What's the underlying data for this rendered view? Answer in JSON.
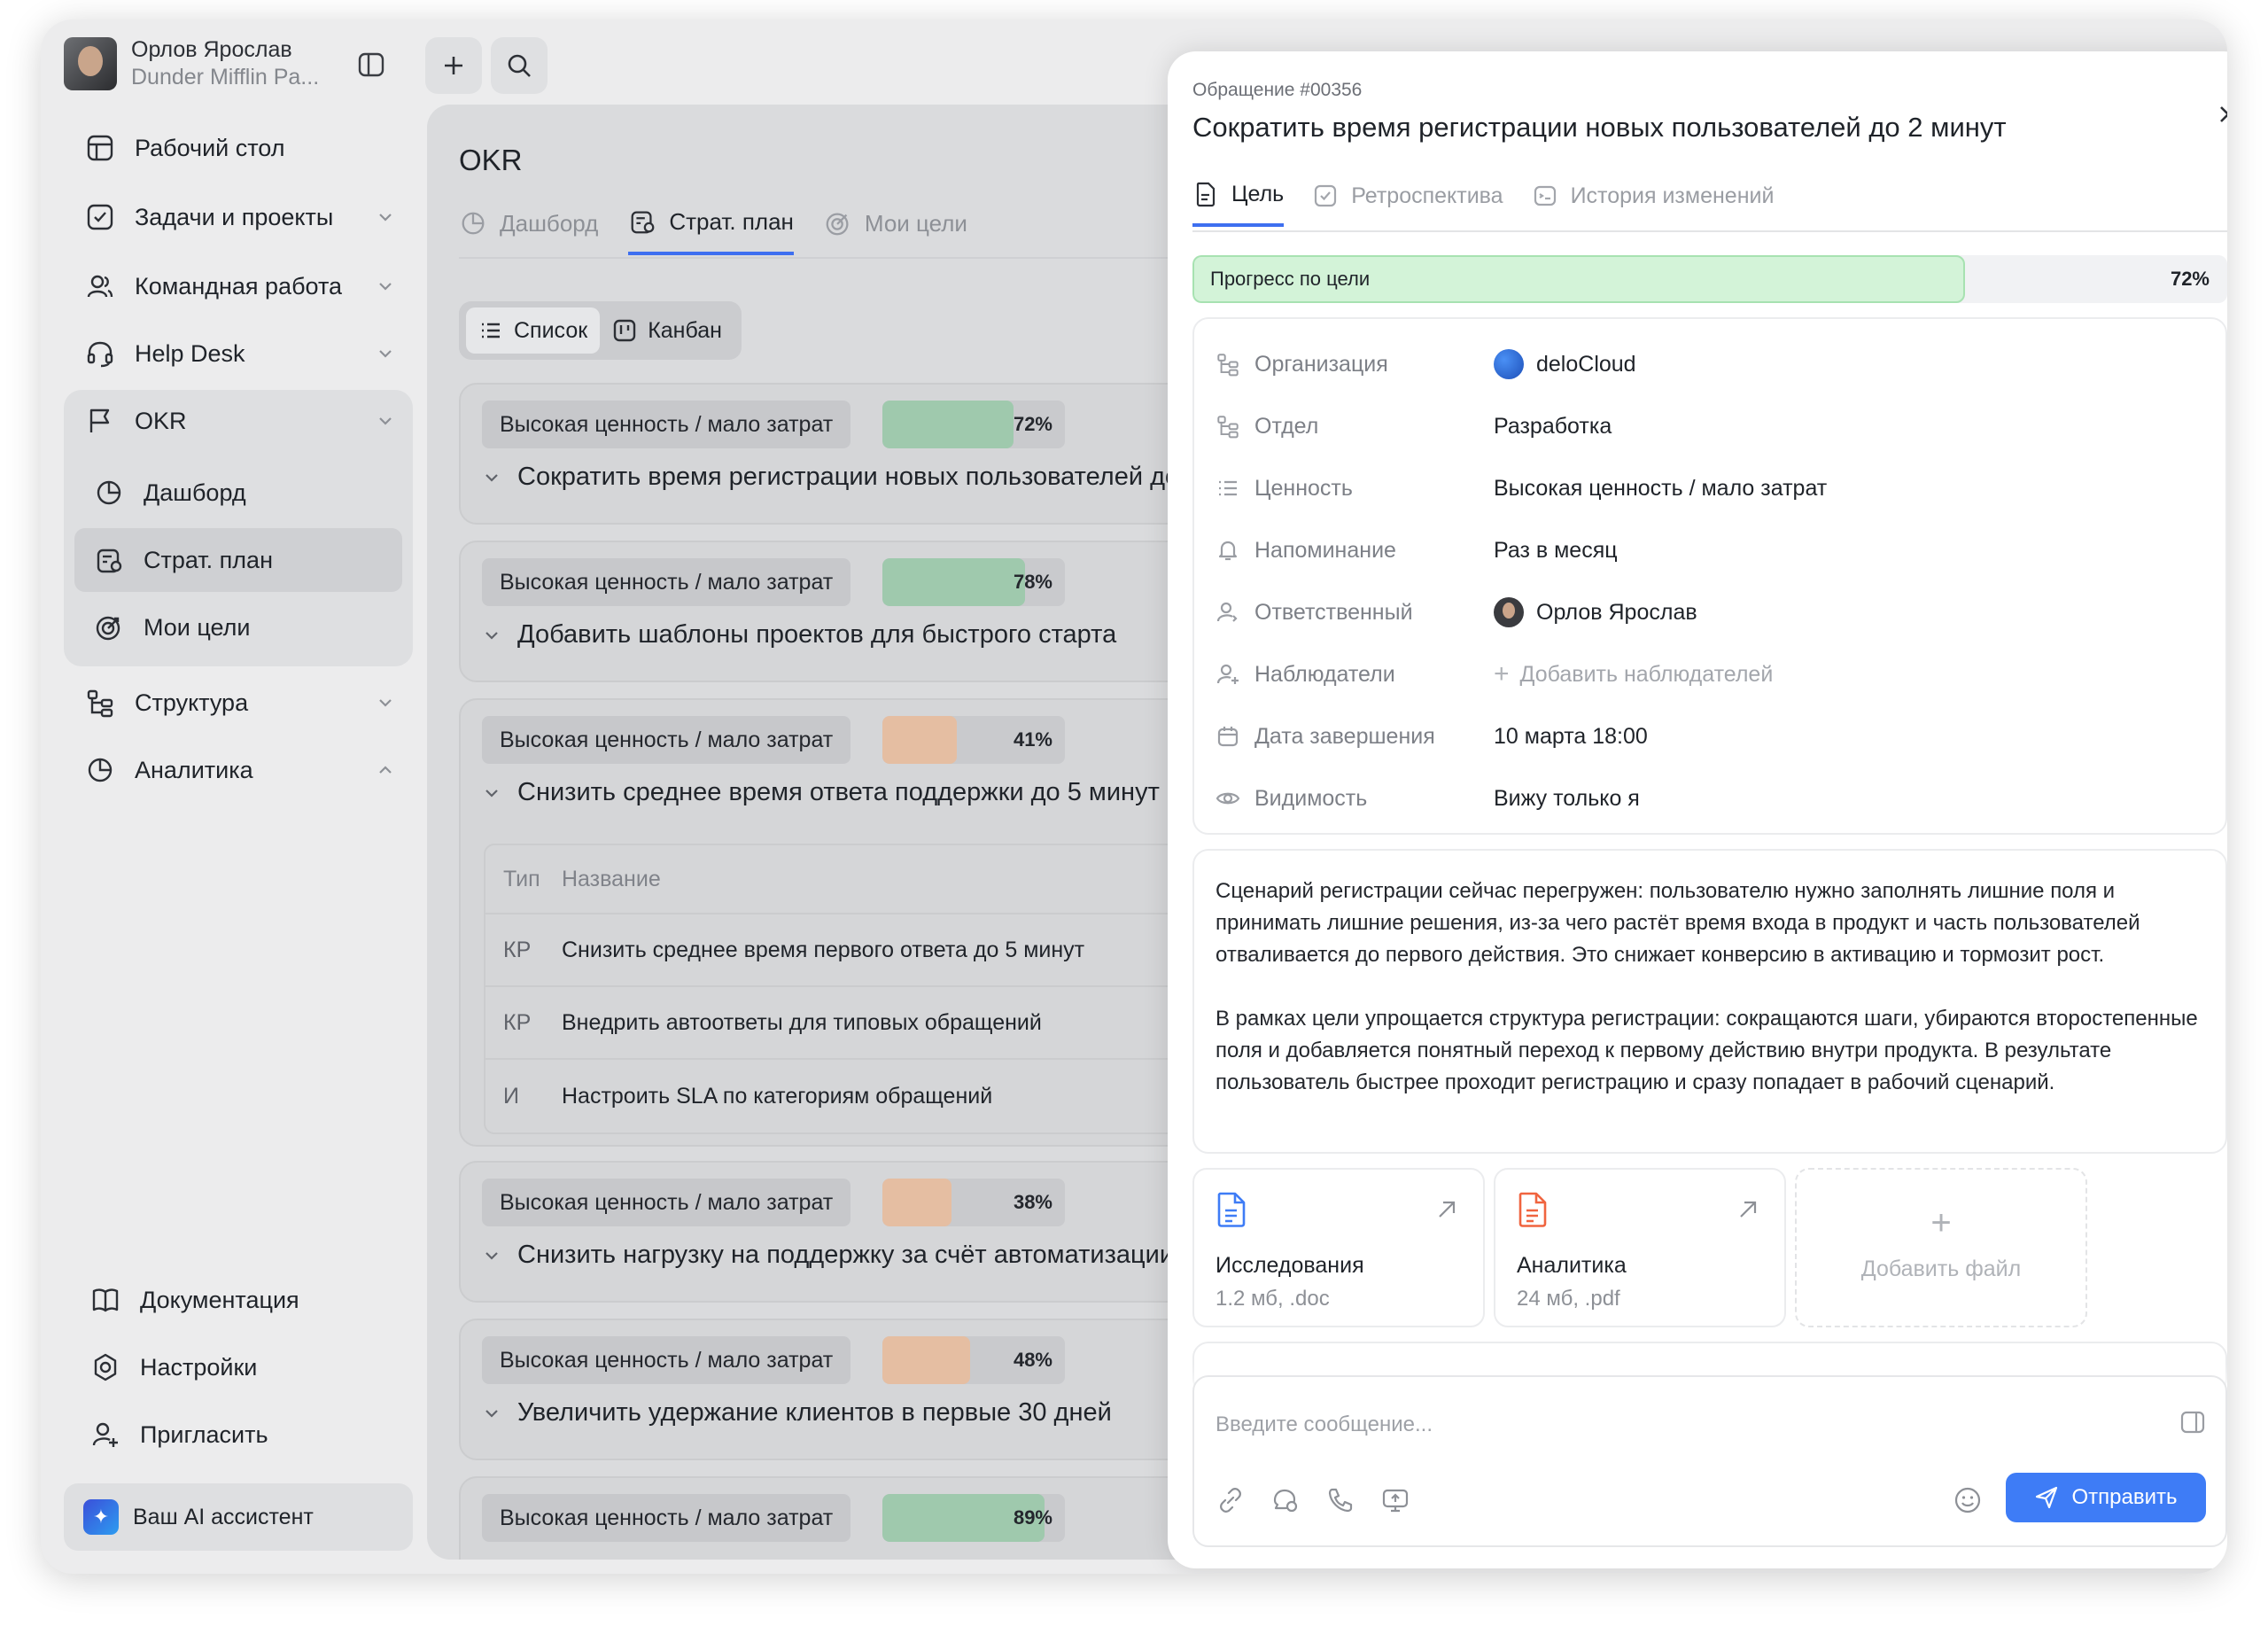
{
  "user": {
    "name": "Орлов Ярослав",
    "org": "Dunder Mifflin Pa..."
  },
  "sidebar": {
    "items": [
      {
        "label": "Рабочий стол"
      },
      {
        "label": "Задачи и проекты"
      },
      {
        "label": "Командная работа"
      },
      {
        "label": "Help Desk"
      },
      {
        "label": "OKR"
      }
    ],
    "okr_sub": [
      {
        "label": "Дашборд"
      },
      {
        "label": "Страт. план"
      },
      {
        "label": "Мои цели"
      }
    ],
    "items2": [
      {
        "label": "Структура"
      },
      {
        "label": "Аналитика"
      }
    ],
    "bottom": [
      {
        "label": "Документация"
      },
      {
        "label": "Настройки"
      },
      {
        "label": "Пригласить"
      }
    ],
    "ai_label": "Ваш AI ассистент"
  },
  "main": {
    "title": "OKR",
    "tabs": [
      {
        "label": "Дашборд"
      },
      {
        "label": "Страт. план"
      },
      {
        "label": "Мои цели"
      }
    ],
    "views": [
      {
        "label": "Список"
      },
      {
        "label": "Канбан"
      }
    ],
    "cards": [
      {
        "chip": "Высокая ценность / мало затрат",
        "progress": "72%",
        "title": "Сократить время регистрации новых пользователей до 2 минут"
      },
      {
        "chip": "Высокая ценность / мало затрат",
        "progress": "78%",
        "title": "Добавить шаблоны проектов для быстрого старта"
      },
      {
        "chip": "Высокая ценность / мало затрат",
        "progress": "41%",
        "title": "Снизить среднее время ответа поддержки до 5 минут"
      },
      {
        "chip": "Высокая ценность / мало затрат",
        "progress": "38%",
        "title": "Снизить нагрузку на поддержку за счёт автоматизации"
      },
      {
        "chip": "Высокая ценность / мало затрат",
        "progress": "48%",
        "title": "Увеличить удержание клиентов в первые 30 дней"
      },
      {
        "chip": "Высокая ценность / мало затрат",
        "progress": "89%"
      }
    ],
    "table": {
      "headers": {
        "type": "Тип",
        "name": "Название"
      },
      "rows": [
        {
          "type": "КР",
          "name": "Снизить среднее время первого ответа до 5 минут"
        },
        {
          "type": "КР",
          "name": "Внедрить автоответы для типовых обращений"
        },
        {
          "type": "И",
          "name": "Настроить SLA по категориям обращений"
        }
      ]
    }
  },
  "modal": {
    "ticket": "Обращение #00356",
    "title": "Сократить время регистрации новых пользователей до 2 минут",
    "tabs": [
      {
        "label": "Цель"
      },
      {
        "label": "Ретроспектива"
      },
      {
        "label": "История изменений"
      }
    ],
    "progress_label": "Прогресс по цели",
    "progress": "72%",
    "props": {
      "org": {
        "key": "Организация",
        "value": "deloCloud"
      },
      "dept": {
        "key": "Отдел",
        "value": "Разработка"
      },
      "value": {
        "key": "Ценность",
        "value": "Высокая ценность / мало затрат"
      },
      "reminder": {
        "key": "Напоминание",
        "value": "Раз в месяц"
      },
      "owner": {
        "key": "Ответственный",
        "value": "Орлов Ярослав"
      },
      "watchers": {
        "key": "Наблюдатели",
        "value": "Добавить наблюдателей"
      },
      "due": {
        "key": "Дата завершения",
        "value": "10 марта 18:00"
      },
      "visibility": {
        "key": "Видимость",
        "value": "Вижу только я"
      }
    },
    "description": {
      "p1": "Сценарий регистрации сейчас перегружен: пользователю нужно заполнять лишние поля и принимать лишние решения, из-за чего растёт время входа в продукт и часть пользователей отваливается до первого действия. Это снижает конверсию в активацию и тормозит рост.",
      "p2": "В рамках цели упрощается структура регистрации: сокращаются шаги, убираются второстепенные поля и добавляется понятный переход к первому действию внутри продукта. В результате пользователь быстрее проходит регистрацию и сразу попадает в рабочий сценарий."
    },
    "files": [
      {
        "name": "Исследования",
        "meta": "1.2 мб, .doc",
        "color": "#3e7cf6"
      },
      {
        "name": "Аналитика",
        "meta": "24 мб, .pdf",
        "color": "#f0643f"
      }
    ],
    "add_file": "Добавить файл",
    "composer": {
      "placeholder": "Введите сообщение...",
      "send": "Отправить"
    }
  }
}
